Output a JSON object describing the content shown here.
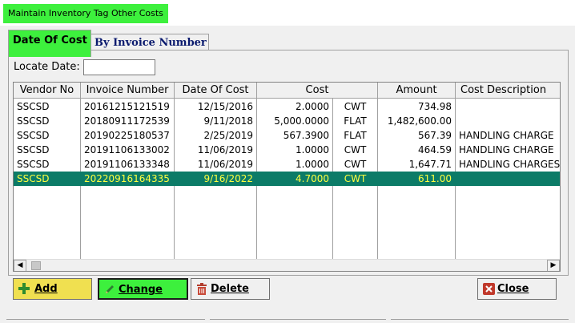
{
  "window": {
    "title": "Maintain Inventory Tag Other Costs"
  },
  "tabs": [
    {
      "label": "Date Of Cost",
      "active": true
    },
    {
      "label": "By Invoice Number",
      "active": false
    }
  ],
  "locate": {
    "label": "Locate Date:",
    "value": ""
  },
  "grid": {
    "columns": [
      "Vendor No",
      "Invoice Number",
      "Date Of Cost",
      "Cost",
      "Amount",
      "Cost Description"
    ],
    "rows": [
      {
        "vendor": "SSCSD",
        "invoice": "20161215121519",
        "date": "12/15/2016",
        "cost": "2.0000",
        "unit": "CWT",
        "amount": "734.98",
        "description": ""
      },
      {
        "vendor": "SSCSD",
        "invoice": "20180911172539",
        "date": "9/11/2018",
        "cost": "5,000.0000",
        "unit": "FLAT",
        "amount": "1,482,600.00",
        "description": ""
      },
      {
        "vendor": "SSCSD",
        "invoice": "20190225180537",
        "date": "2/25/2019",
        "cost": "567.3900",
        "unit": "FLAT",
        "amount": "567.39",
        "description": "HANDLING CHARGE"
      },
      {
        "vendor": "SSCSD",
        "invoice": "20191106133002",
        "date": "11/06/2019",
        "cost": "1.0000",
        "unit": "CWT",
        "amount": "464.59",
        "description": "HANDLING CHARGE"
      },
      {
        "vendor": "SSCSD",
        "invoice": "20191106133348",
        "date": "11/06/2019",
        "cost": "1.0000",
        "unit": "CWT",
        "amount": "1,647.71",
        "description": "HANDLING CHARGES"
      },
      {
        "vendor": "SSCSD",
        "invoice": "20220916164335",
        "date": "9/16/2022",
        "cost": "4.7000",
        "unit": "CWT",
        "amount": "611.00",
        "description": "",
        "selected": true
      }
    ]
  },
  "buttons": {
    "add": "Add",
    "change": "Change",
    "delete": "Delete",
    "close": "Close"
  },
  "colors": {
    "highlight_green": "#3df03d",
    "selected_row_bg": "#0c7b67",
    "selected_row_text": "#ffff40",
    "add_button": "#f0e050"
  }
}
